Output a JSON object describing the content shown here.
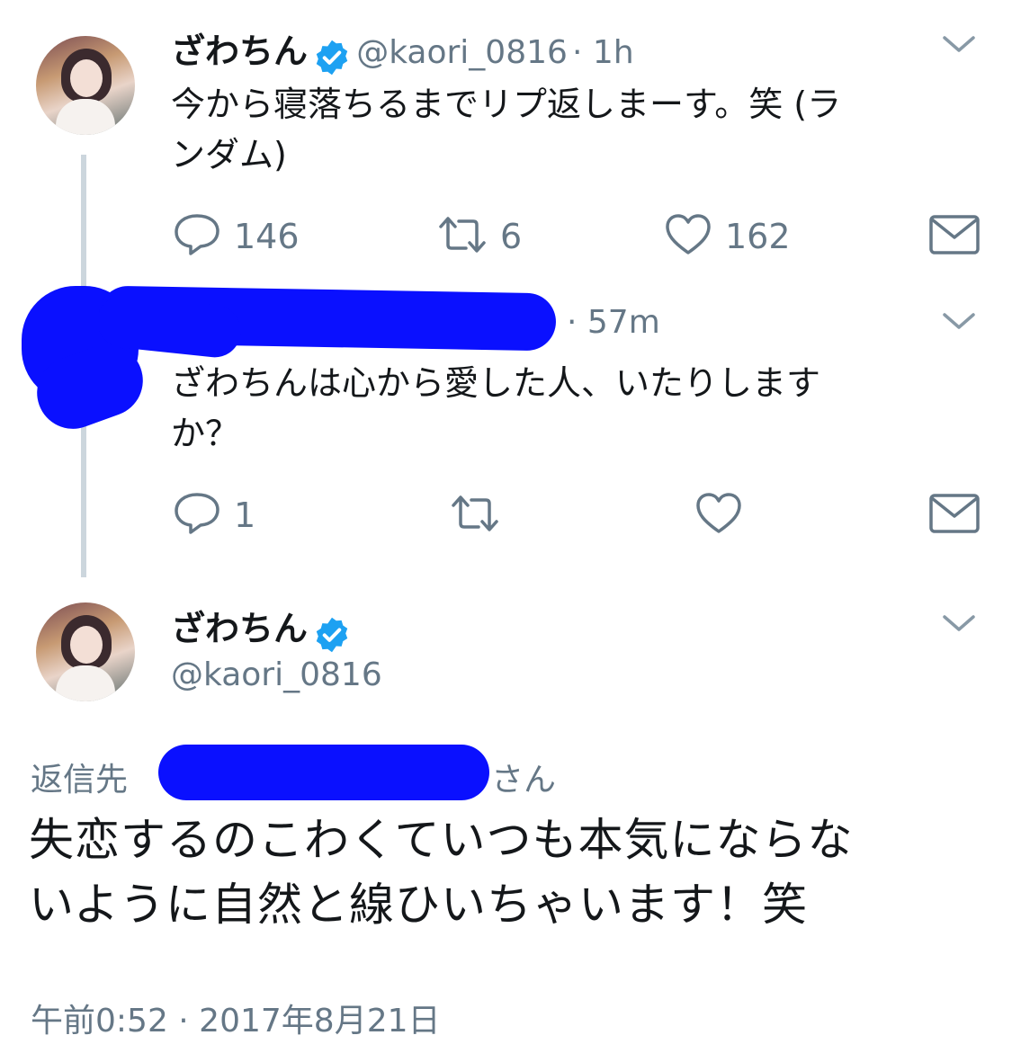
{
  "tweet1": {
    "name": "ざわちん",
    "handle": "@kaori_0816",
    "time": "· 1h",
    "text_line1": "今から寝落ちるまでリプ返しまーす。笑 (ラ",
    "text_line2": "ンダム)",
    "replies": "146",
    "retweets": "6",
    "likes": "162"
  },
  "tweet2": {
    "time": "· 57m",
    "text_line1": "ざわちんは心から愛した人、いたりします",
    "text_line2": "か？",
    "replies": "1"
  },
  "main_tweet": {
    "name": "ざわちん",
    "handle": "@kaori_0816",
    "reply_prefix": "返信先",
    "reply_suffix": "さん",
    "text_line1": "失恋するのこわくていつも本気にならな",
    "text_line2": "いように自然と線ひいちゃいます！笑",
    "timestamp": "午前0:52 · 2017年8月21日"
  },
  "colors": {
    "text": "#14171a",
    "secondary": "#657786",
    "verified": "#1da1f2",
    "thread_line": "#ccd6dd",
    "scribble": "#0a10ff"
  },
  "icons": [
    "reply-icon",
    "retweet-icon",
    "like-icon",
    "dm-icon",
    "chevron-down-icon",
    "verified-badge-icon"
  ]
}
